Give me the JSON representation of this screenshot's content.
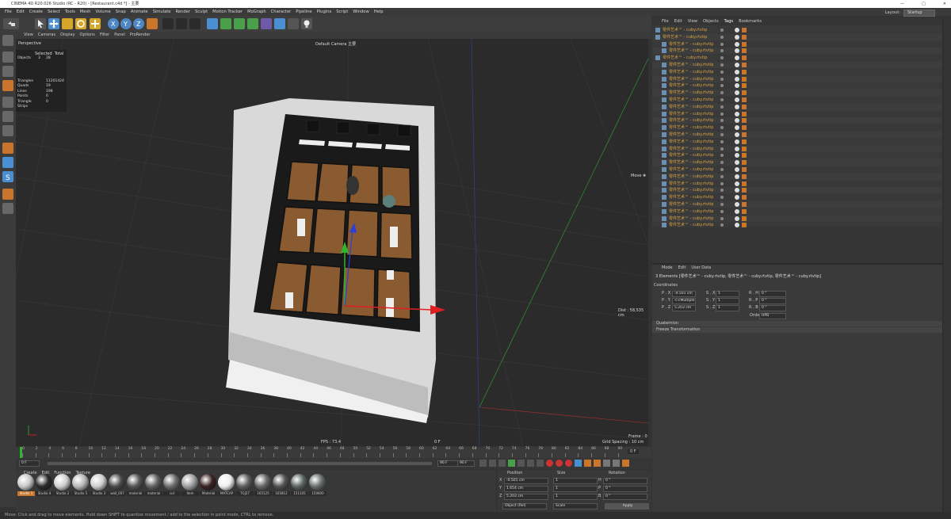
{
  "window": {
    "title": "CINEMA 4D R20.026 Studio (RC - R20) - [Restaurant.c4d *] - 主要",
    "controls": [
      "—",
      "□",
      "✕"
    ]
  },
  "menubar": {
    "items": [
      "File",
      "Edit",
      "Create",
      "Select",
      "Tools",
      "Mesh",
      "Volume",
      "Snap",
      "Animate",
      "Simulate",
      "Render",
      "Sculpt",
      "Motion Tracker",
      "MoGraph",
      "Character",
      "Pipeline",
      "Plugins",
      "Script",
      "Window",
      "Help"
    ],
    "layout_label": "Layout:",
    "layout_value": "Startup"
  },
  "viewport": {
    "menu": [
      "View",
      "Cameras",
      "Display",
      "Options",
      "Filter",
      "Panel",
      "ProRender"
    ],
    "name": "Perspective",
    "camera": "Default Camera ",
    "camera_mode": "主要",
    "stats_header": [
      "Selected",
      "Total"
    ],
    "stats": [
      {
        "label": "Objects",
        "sel": "3",
        "total": "28"
      },
      {
        "label": "Triangles",
        "sel": "",
        "total": "11201424"
      },
      {
        "label": "Quads",
        "sel": "",
        "total": "19"
      },
      {
        "label": "Lines",
        "sel": "",
        "total": "198"
      },
      {
        "label": "Points",
        "sel": "",
        "total": "0"
      },
      {
        "label": "Triangle Strips",
        "sel": "",
        "total": "0"
      }
    ],
    "move_label": "Move ✥",
    "dist_label": "Dist : 58,535 cm",
    "fps": "FPS : 73.4",
    "frame_zero": "0 F",
    "frame": "Frame : 0",
    "grid": "Grid Spacing : 10 cm"
  },
  "timeline": {
    "ticks": [
      "0",
      "2",
      "4",
      "6",
      "8",
      "10",
      "12",
      "14",
      "16",
      "18",
      "20",
      "22",
      "24",
      "26",
      "28",
      "30",
      "32",
      "34",
      "36",
      "38",
      "40",
      "42",
      "44",
      "46",
      "48",
      "50",
      "52",
      "54",
      "56",
      "58",
      "60",
      "62",
      "64",
      "66",
      "68",
      "70",
      "72",
      "74",
      "76",
      "78",
      "80",
      "82",
      "84",
      "86",
      "88",
      "90"
    ],
    "end": "0 F",
    "start": "0 F",
    "min": "0 F",
    "max": "90 F",
    "cur": "90 F"
  },
  "materials": {
    "menu": [
      "Create",
      "Edit",
      "Function",
      "Texture"
    ],
    "items": [
      {
        "name": "Studio 1",
        "color": "#c8c8c8"
      },
      {
        "name": "Studio 4",
        "color": "#2a2a2a"
      },
      {
        "name": "Studio 2",
        "color": "#d0d0d0"
      },
      {
        "name": "Studio 5",
        "color": "#b8b8b8"
      },
      {
        "name": "Studio 3",
        "color": "#cfcfcf"
      },
      {
        "name": "wall_007",
        "color": "#4a4a4a"
      },
      {
        "name": "material",
        "color": "#555555"
      },
      {
        "name": "material",
        "color": "#606060"
      },
      {
        "name": "cut",
        "color": "#6b6b6b"
      },
      {
        "name": "Item",
        "color": "#a0a0a0"
      },
      {
        "name": "Material",
        "color": "#3b2222"
      },
      {
        "name": "MATCAP",
        "color": "#eeeeee"
      },
      {
        "name": "TGJ27",
        "color": "#5e5e5e"
      },
      {
        "name": "165125",
        "color": "#666666"
      },
      {
        "name": "165812",
        "color": "#525252"
      },
      {
        "name": "151105",
        "color": "#5b6560"
      },
      {
        "name": "150600",
        "color": "#6a6f6a"
      }
    ],
    "logo": "MAXON CINEMA 4D"
  },
  "coords": {
    "headers": [
      "Position",
      "Size",
      "Rotation"
    ],
    "rows": [
      {
        "axis": "X",
        "pos": "-0.501 cm",
        "size": "1",
        "rot_axis": "H",
        "rot": "0 °"
      },
      {
        "axis": "Y",
        "pos": "1.654 cm",
        "size": "1",
        "rot_axis": "P",
        "rot": "0 °"
      },
      {
        "axis": "Z",
        "pos": "5.203 cm",
        "size": "1",
        "rot_axis": "B",
        "rot": "0 °"
      }
    ],
    "mode_a": "Object (Rel)",
    "mode_b": "Scale",
    "apply": "Apply"
  },
  "objects": {
    "menu": [
      "File",
      "Edit",
      "View",
      "Objects",
      "Tags",
      "Bookmarks"
    ],
    "rows": [
      {
        "name": "零件艺术™ - cuby.rtvtip",
        "indent": 0
      },
      {
        "name": "零件艺术™ - cuby.rtvtip",
        "indent": 0
      },
      {
        "name": "零件艺术™ - cuby.rtvtip",
        "indent": 1
      },
      {
        "name": "零件艺术™ - cuby.rtvtip",
        "indent": 1
      },
      {
        "name": "零件艺术™ - cuby.rtvtip",
        "indent": 0
      },
      {
        "name": "零件艺术™ - cuby.rtvtip",
        "indent": 1
      },
      {
        "name": "零件艺术™ - cuby.rtvtip",
        "indent": 1
      },
      {
        "name": "零件艺术™ - cuby.rtvtip",
        "indent": 1
      },
      {
        "name": "零件艺术™ - cuby.rtvtip",
        "indent": 1
      },
      {
        "name": "零件艺术™ - cuby.rtvtip",
        "indent": 1
      },
      {
        "name": "零件艺术™ - cuby.rtvtip",
        "indent": 1
      },
      {
        "name": "零件艺术™ - cuby.rtvtip",
        "indent": 1
      },
      {
        "name": "零件艺术™ - cuby.rtvtip",
        "indent": 1
      },
      {
        "name": "零件艺术™ - cuby.rtvtip",
        "indent": 1
      },
      {
        "name": "零件艺术™ - cuby.rtvtip",
        "indent": 1
      },
      {
        "name": "零件艺术™ - cuby.rtvtip",
        "indent": 1
      },
      {
        "name": "零件艺术™ - cuby.rtvtip",
        "indent": 1
      },
      {
        "name": "零件艺术™ - cuby.rtvtip",
        "indent": 1
      },
      {
        "name": "零件艺术™ - cuby.rtvtip",
        "indent": 1
      },
      {
        "name": "零件艺术™ - cuby.rtvtip",
        "indent": 1
      },
      {
        "name": "零件艺术™ - cuby.rtvtip",
        "indent": 1
      },
      {
        "name": "零件艺术™ - cuby.rtvtip",
        "indent": 1
      },
      {
        "name": "零件艺术™ - cuby.rtvtip",
        "indent": 1
      },
      {
        "name": "零件艺术™ - cuby.rtvtip",
        "indent": 1
      },
      {
        "name": "零件艺术™ - cuby.rtvtip",
        "indent": 1
      },
      {
        "name": "零件艺术™ - cuby.rtvtip",
        "indent": 1
      },
      {
        "name": "零件艺术™ - cuby.rtvtip",
        "indent": 1
      },
      {
        "name": "零件艺术™ - cuby.rtvtip",
        "indent": 1
      },
      {
        "name": "零件艺术™ - cuby.rtvtip",
        "indent": 1
      }
    ]
  },
  "attributes": {
    "menu": [
      "Mode",
      "Edit",
      "User Data"
    ],
    "selection": "3 Elements [零件艺术™ - cuby.rtvtip, 零件艺术™ - cuby.rtvtip, 零件艺术™ - cuby.rtvtip]",
    "section": "Coordinates",
    "rows": [
      {
        "p_label": "P . X",
        "p": "-0.501 cm",
        "s_label": "S . X",
        "s": "1",
        "r_label": "R . H",
        "r": "0 °"
      },
      {
        "p_label": "P . Y",
        "p": "<<Multiple Values>>",
        "s_label": "S . Y",
        "s": "1",
        "r_label": "R . P",
        "r": "0 °"
      },
      {
        "p_label": "P . Z",
        "p": "5.203 cm",
        "s_label": "S . Z",
        "s": "1",
        "r_label": "R . B",
        "r": "0 °"
      }
    ],
    "order_label": "Order",
    "order_value": "HPB",
    "groups": [
      "Quaternion",
      "Freeze Transformation"
    ]
  }
}
